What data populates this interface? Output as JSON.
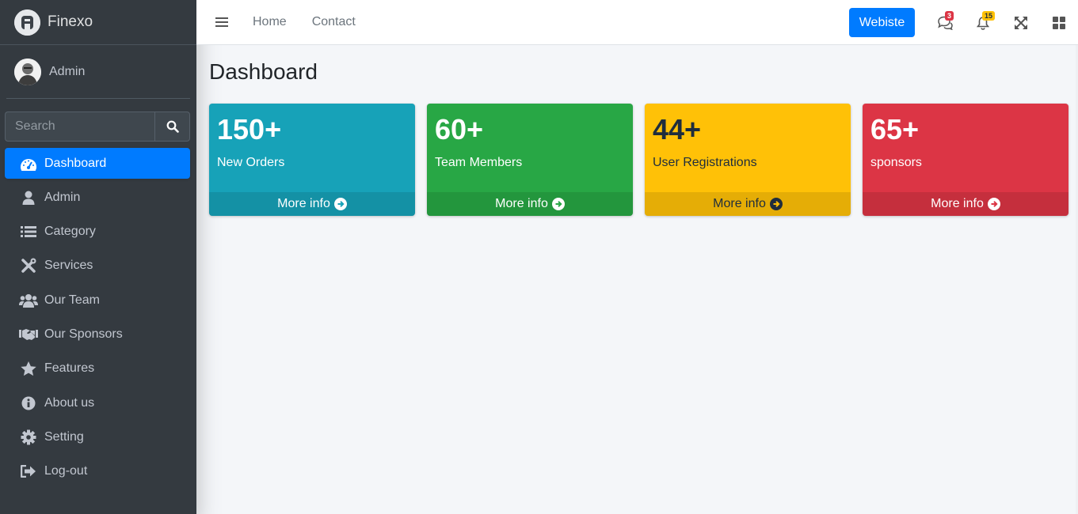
{
  "brand": {
    "name": "Finexo",
    "logo_letter": "R"
  },
  "user": {
    "name": "Admin"
  },
  "search": {
    "placeholder": "Search"
  },
  "sidebar": {
    "items": [
      {
        "label": "Dashboard",
        "icon": "tachometer-icon",
        "active": true
      },
      {
        "label": "Admin",
        "icon": "user-icon"
      },
      {
        "label": "Category",
        "icon": "list-icon"
      },
      {
        "label": "Services",
        "icon": "tools-icon"
      },
      {
        "label": "Our Team",
        "icon": "users-icon"
      },
      {
        "label": "Our Sponsors",
        "icon": "handshake-icon"
      },
      {
        "label": "Features",
        "icon": "star-icon"
      },
      {
        "label": "About us",
        "icon": "info-circle-icon"
      },
      {
        "label": "Setting",
        "icon": "gear-icon"
      },
      {
        "label": "Log-out",
        "icon": "sign-out-icon"
      }
    ]
  },
  "topbar": {
    "links": [
      "Home",
      "Contact"
    ],
    "website_button": "Webiste",
    "messages_badge": "3",
    "notifications_badge": "15"
  },
  "page": {
    "title": "Dashboard"
  },
  "cards": [
    {
      "value": "150+",
      "label": "New Orders",
      "footer": "More info",
      "color": "#17a2b8"
    },
    {
      "value": "60+",
      "label": "Team Members",
      "footer": "More info",
      "color": "#28a745"
    },
    {
      "value": "44+",
      "label": "User Registrations",
      "footer": "More info",
      "color": "#ffc107"
    },
    {
      "value": "65+",
      "label": "sponsors",
      "footer": "More info",
      "color": "#dc3545"
    }
  ],
  "colors": {
    "sidebar": "#343a40",
    "primary": "#007bff",
    "background": "#f4f6f9"
  }
}
